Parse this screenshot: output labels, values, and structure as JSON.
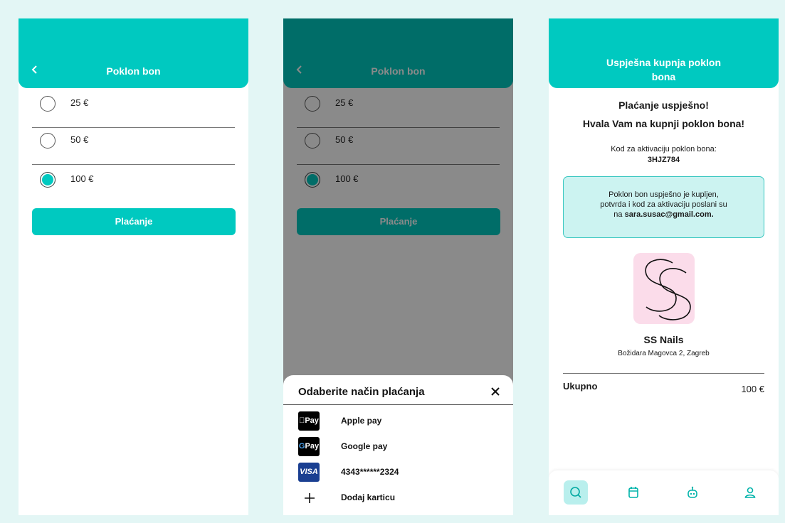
{
  "screen_select": {
    "header_title": "Poklon bon",
    "options": [
      {
        "label": "25 €",
        "selected": false
      },
      {
        "label": "50 €",
        "selected": false
      },
      {
        "label": "100 €",
        "selected": true
      }
    ],
    "pay_button": "Plaćanje"
  },
  "screen_payment": {
    "header_title": "Poklon bon",
    "options": [
      {
        "label": "25 €",
        "selected": false
      },
      {
        "label": "50 €",
        "selected": false
      },
      {
        "label": "100 €",
        "selected": true
      }
    ],
    "pay_button": "Plaćanje",
    "sheet": {
      "title": "Odaberite način plaćanja",
      "methods": [
        {
          "icon": "apple-pay-icon",
          "logo_text": "Pay",
          "label": "Apple pay"
        },
        {
          "icon": "google-pay-icon",
          "logo_text": "Pay",
          "label": "Google pay"
        },
        {
          "icon": "visa-icon",
          "logo_text": "VISA",
          "label": "4343******2324"
        },
        {
          "icon": "plus-icon",
          "logo_text": "",
          "label": "Dodaj karticu"
        }
      ]
    }
  },
  "screen_success": {
    "header_title_line1": "Uspješna kupnja poklon",
    "header_title_line2": "bona",
    "title": "Plaćanje uspješno!",
    "subtitle": "Hvala Vam na kupnji poklon bona!",
    "code_label": "Kod za aktivaciju poklon bona:",
    "code": "3HJZ784",
    "info_line1": "Poklon bon uspješno je kupljen,",
    "info_line2": "potvrda i kod za aktivaciju poslani su",
    "info_prefix": "na",
    "info_email": "sara.susac@gmail.com.",
    "salon_logo_text": "SS",
    "salon_name": "SS Nails",
    "salon_address": "Božidara Magovca 2, Zagreb",
    "total_label": "Ukupno",
    "total_value": "100 €",
    "nav": [
      "search-icon",
      "calendar-icon",
      "robot-icon",
      "profile-icon"
    ]
  },
  "colors": {
    "accent": "#00c9c0",
    "background": "#e3f6f5",
    "info_box": "#ccf3f1",
    "logo_bg": "#fbdcea"
  }
}
